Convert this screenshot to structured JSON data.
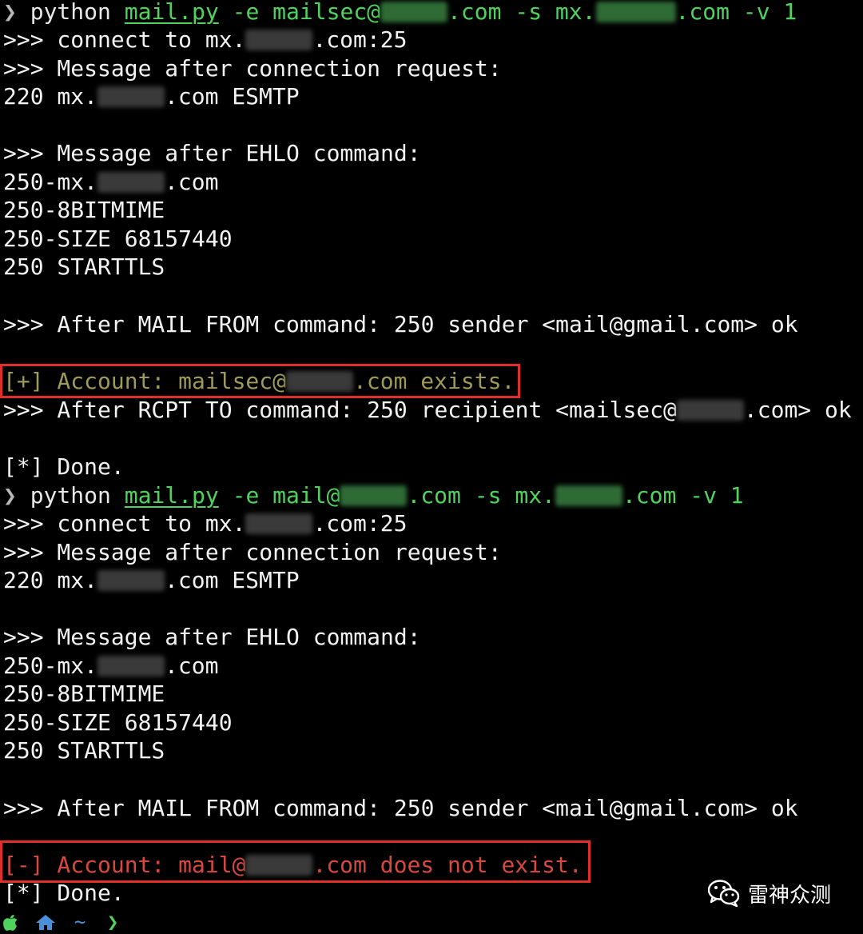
{
  "terminal": {
    "run1": {
      "prompt_arrow": "❯",
      "cmd_python": "python",
      "cmd_script": "mail.py",
      "cmd_email_flag": "-e mailsec@",
      "cmd_email_tail": ".com",
      "cmd_server_flag": "-s mx.",
      "cmd_server_tail": ".com",
      "cmd_verbose": "-v 1",
      "lines": {
        "connect_prefix": ">>> connect to mx.",
        "connect_suffix": ".com:25",
        "msg_after_conn": ">>> Message after connection request:",
        "banner_prefix": "220 mx.",
        "banner_suffix": ".com ESMTP",
        "msg_after_ehlo": ">>> Message after EHLO command:",
        "ehlo_host_prefix": "250-mx.",
        "ehlo_host_suffix": ".com",
        "ehlo_8bit": "250-8BITMIME",
        "ehlo_size": "250-SIZE 68157440",
        "ehlo_starttls": "250 STARTTLS",
        "mail_from": ">>> After MAIL FROM command: 250 sender <mail@gmail.com> ok",
        "result_prefix": "[+] Account: mailsec@",
        "result_suffix": ".com exists.",
        "rcpt_prefix": ">>> After RCPT TO command: 250 recipient <mailsec@",
        "rcpt_suffix": ".com> ok",
        "done": "[*] Done."
      }
    },
    "run2": {
      "prompt_arrow": "❯",
      "cmd_python": "python",
      "cmd_script": "mail.py",
      "cmd_email_flag": "-e mail@",
      "cmd_email_tail": ".com",
      "cmd_server_flag": "-s mx.",
      "cmd_server_tail": ".com",
      "cmd_verbose": "-v 1",
      "lines": {
        "connect_prefix": ">>> connect to mx.",
        "connect_suffix": ".com:25",
        "msg_after_conn": ">>> Message after connection request:",
        "banner_prefix": "220 mx.",
        "banner_suffix": ".com ESMTP",
        "msg_after_ehlo": ">>> Message after EHLO command:",
        "ehlo_host_prefix": "250-mx.",
        "ehlo_host_suffix": ".com",
        "ehlo_8bit": "250-8BITMIME",
        "ehlo_size": "250-SIZE 68157440",
        "ehlo_starttls": "250 STARTTLS",
        "mail_from": ">>> After MAIL FROM command: 250 sender <mail@gmail.com> ok",
        "result_prefix": "[-] Account: mail@",
        "result_suffix": ".com does not exist.",
        "done": "[*] Done."
      }
    },
    "bottom_prompt": {
      "tilde": "~",
      "arrow": "❯"
    }
  },
  "watermark": {
    "text": "雷神众测",
    "icon": "wechat-icon"
  },
  "colors": {
    "command_green": "#4fd35d",
    "success_text": "#9e9a5a",
    "error_text": "#d8483f",
    "highlight_box": "#e02f2a"
  }
}
